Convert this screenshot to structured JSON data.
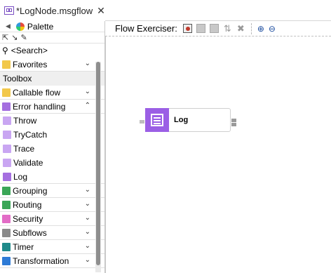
{
  "tab": {
    "title": "*LogNode.msgflow",
    "close": "✕",
    "icon": "msgflow-file-icon"
  },
  "palette": {
    "title": "Palette",
    "search_placeholder": "<Search>",
    "favorites": "Favorites",
    "toolbox_label": "Toolbox",
    "groups": [
      {
        "label": "Callable flow",
        "expanded": false
      },
      {
        "label": "Error handling",
        "expanded": true
      }
    ],
    "error_handling_items": [
      "Throw",
      "TryCatch",
      "Trace",
      "Validate",
      "Log"
    ],
    "more_groups": [
      "Grouping",
      "Routing",
      "Security",
      "Subflows",
      "Timer",
      "Transformation"
    ]
  },
  "editor": {
    "exerciser_label": "Flow Exerciser:",
    "node_label": "Log"
  },
  "colors": {
    "accent": "#9b5fe5",
    "selection": "#efefef"
  }
}
